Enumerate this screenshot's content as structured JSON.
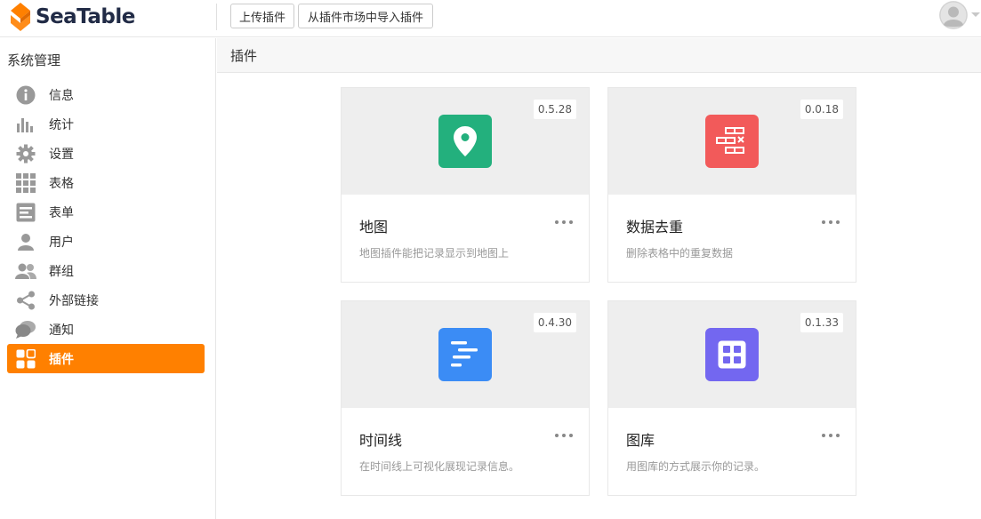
{
  "app": {
    "brand": "SeaTable"
  },
  "header": {
    "upload_label": "上传插件",
    "market_label": "从插件市场中导入插件"
  },
  "sidebar": {
    "title": "系统管理",
    "items": [
      {
        "label": "信息",
        "icon": "info-icon"
      },
      {
        "label": "统计",
        "icon": "bar-chart-icon"
      },
      {
        "label": "设置",
        "icon": "gear-icon"
      },
      {
        "label": "表格",
        "icon": "grid-icon"
      },
      {
        "label": "表单",
        "icon": "form-icon"
      },
      {
        "label": "用户",
        "icon": "user-icon"
      },
      {
        "label": "群组",
        "icon": "group-icon"
      },
      {
        "label": "外部链接",
        "icon": "share-icon"
      },
      {
        "label": "通知",
        "icon": "chat-icon"
      },
      {
        "label": "插件",
        "icon": "plugin-icon",
        "active": true
      }
    ]
  },
  "main": {
    "title": "插件",
    "plugins": [
      {
        "name": "地图",
        "version": "0.5.28",
        "description": "地图插件能把记录显示到地图上",
        "icon": "map-pin-icon",
        "color": "#23b07d"
      },
      {
        "name": "数据去重",
        "version": "0.0.18",
        "description": "删除表格中的重复数据",
        "icon": "deduplication-icon",
        "color": "#f25a5a"
      },
      {
        "name": "时间线",
        "version": "0.4.30",
        "description": "在时间线上可视化展现记录信息。",
        "icon": "timeline-icon",
        "color": "#3b8cf5"
      },
      {
        "name": "图库",
        "version": "0.1.33",
        "description": "用图库的方式展示你的记录。",
        "icon": "gallery-icon",
        "color": "#7367f0"
      }
    ]
  },
  "colors": {
    "accent": "#ff8000",
    "brand_dark": "#212b46"
  }
}
